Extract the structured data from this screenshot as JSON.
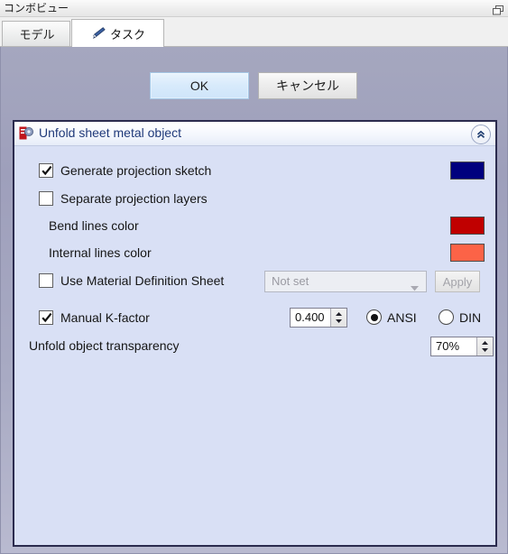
{
  "window": {
    "title": "コンボビュー",
    "float_icon": "float-window-icon"
  },
  "tabs": [
    {
      "label": "モデル",
      "active": false,
      "icon": ""
    },
    {
      "label": "タスク",
      "active": true,
      "icon": "pencil-icon"
    }
  ],
  "dialog_buttons": {
    "ok_label": "OK",
    "cancel_label": "キャンセル"
  },
  "group": {
    "title": "Unfold sheet metal object",
    "icon": "freecad-sheetmetal-unfold-icon",
    "collapse_icon": "chevron-double-up-icon",
    "rows": {
      "generate_projection_sketch": {
        "label": "Generate projection sketch",
        "checked": true,
        "color": "#00007e"
      },
      "separate_projection_layers": {
        "label": "Separate projection layers",
        "checked": false
      },
      "bend_lines_color": {
        "label": "Bend lines color",
        "color": "#c00000"
      },
      "internal_lines_color": {
        "label": "Internal lines color",
        "color": "#fc6347"
      },
      "use_material_definition_sheet": {
        "label": "Use Material Definition Sheet",
        "checked": false,
        "combo_value": "Not set",
        "apply_label": "Apply"
      },
      "manual_k_factor": {
        "label": "Manual K-factor",
        "checked": true,
        "value": "0.400",
        "standard_ansi_label": "ANSI",
        "standard_din_label": "DIN",
        "standard_selected": "ANSI"
      },
      "unfold_object_transparency": {
        "label": "Unfold object transparency",
        "value": "70%"
      }
    }
  }
}
